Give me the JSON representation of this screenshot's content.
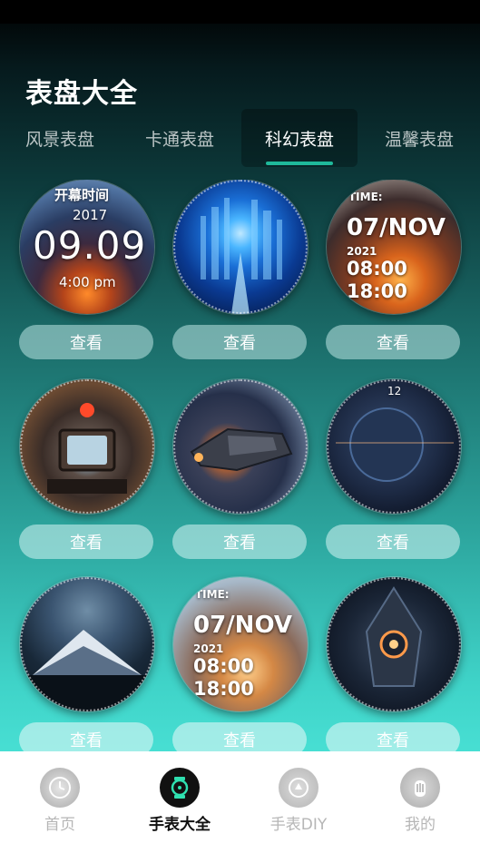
{
  "header": {
    "title": "表盘大全"
  },
  "tabs": [
    {
      "label": "风景表盘",
      "active": false
    },
    {
      "label": "卡通表盘",
      "active": false
    },
    {
      "label": "科幻表盘",
      "active": true
    },
    {
      "label": "温馨表盘",
      "active": false
    }
  ],
  "view_label": "查看",
  "faces": [
    {
      "overlay": {
        "top_text": "开幕时间",
        "year": "2017",
        "time": "09.09",
        "sub": "4:00 pm"
      }
    },
    {
      "overlay": null
    },
    {
      "overlay": {
        "tag": "TIME:",
        "date": "07/NOV",
        "year": "2021",
        "line1": "08:00",
        "line2": "18:00"
      }
    },
    {
      "overlay": null
    },
    {
      "overlay": null
    },
    {
      "overlay": {
        "twelve": "12"
      }
    },
    {
      "overlay": null
    },
    {
      "overlay": {
        "tag": "TIME:",
        "date": "07/NOV",
        "year": "2021",
        "line1": "08:00",
        "line2": "18:00"
      }
    },
    {
      "overlay": null
    }
  ],
  "bottom_nav": [
    {
      "label": "首页",
      "icon": "home-icon",
      "active": false
    },
    {
      "label": "手表大全",
      "icon": "watch-icon",
      "active": true
    },
    {
      "label": "手表DIY",
      "icon": "diy-icon",
      "active": false
    },
    {
      "label": "我的",
      "icon": "profile-icon",
      "active": false
    }
  ],
  "colors": {
    "accent": "#1fb99a",
    "nav_active": "#111111",
    "nav_inactive": "#b6b6b6"
  }
}
